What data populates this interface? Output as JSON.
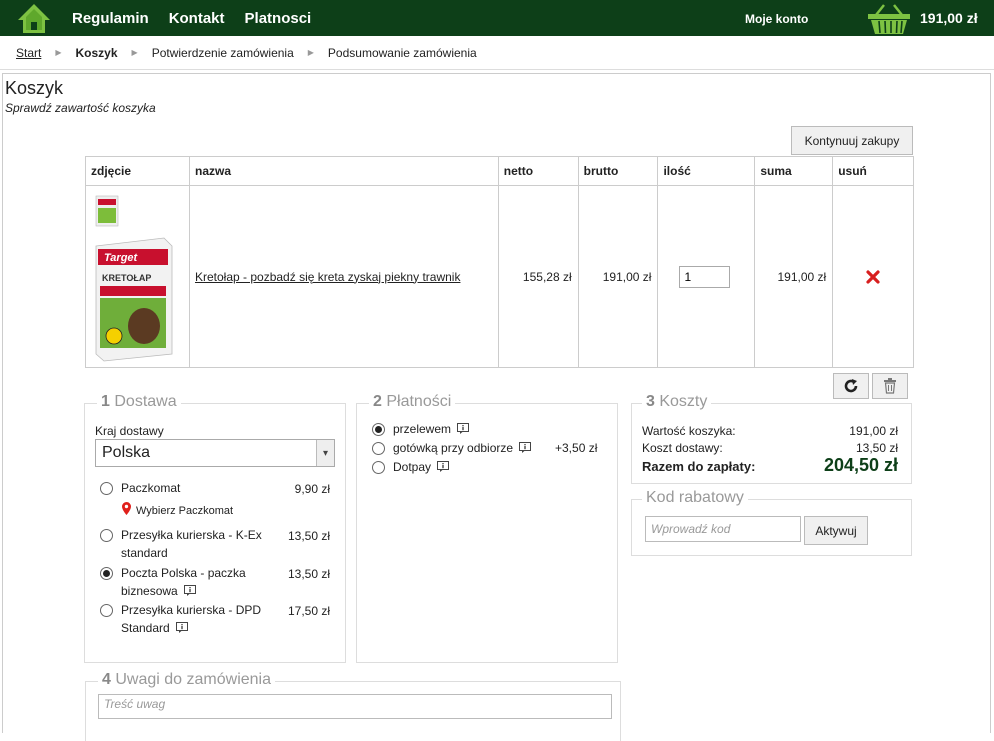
{
  "header": {
    "nav": [
      "Regulamin",
      "Kontakt",
      "Platnosci"
    ],
    "account": "Moje konto",
    "cart_total": "191,00 zł",
    "colors": {
      "bar": "#0d3f18",
      "accent": "#7dc242"
    }
  },
  "breadcrumb": {
    "start": "Start",
    "cart": "Koszyk",
    "confirm": "Potwierdzenie zamówienia",
    "summary": "Podsumowanie zamówienia"
  },
  "page": {
    "title": "Koszyk",
    "subtitle": "Sprawdź zawartość koszyka",
    "continue_button": "Kontynuuj zakupy"
  },
  "table": {
    "headers": [
      "zdjęcie",
      "nazwa",
      "netto",
      "brutto",
      "ilość",
      "suma",
      "usuń"
    ],
    "item": {
      "name": "Kretołap - pozbadź się kreta zyskaj piekny trawnik",
      "netto": "155,28 zł",
      "brutto": "191,00 zł",
      "quantity": "1",
      "sum": "191,00 zł",
      "image_brand": "Target",
      "image_product": "KRETOŁAP"
    }
  },
  "delivery": {
    "num": "1",
    "title": "Dostawa",
    "country_label": "Kraj dostawy",
    "country": "Polska",
    "paczkomat_link": "Wybierz Paczkomat",
    "options": [
      {
        "line1": "Paczkomat",
        "line2": "",
        "price": "9,90 zł",
        "checked": false
      },
      {
        "line1": "Przesyłka kurierska - K-Ex",
        "line2": "standard",
        "price": "13,50 zł",
        "checked": false
      },
      {
        "line1": "Poczta Polska - paczka",
        "line2": "biznesowa",
        "price": "13,50 zł",
        "checked": true
      },
      {
        "line1": "Przesyłka kurierska - DPD",
        "line2": "Standard",
        "price": "17,50 zł",
        "checked": false
      }
    ]
  },
  "payment": {
    "num": "2",
    "title": "Płatności",
    "options": [
      {
        "label": "przelewem",
        "extra": "",
        "checked": true
      },
      {
        "label": "gotówką przy odbiorze",
        "extra": "+3,50 zł",
        "checked": false
      },
      {
        "label": "Dotpay",
        "extra": "",
        "checked": false
      }
    ]
  },
  "costs": {
    "num": "3",
    "title": "Koszty",
    "cart_value_label": "Wartość koszyka:",
    "cart_value": "191,00 zł",
    "shipping_label": "Koszt dostawy:",
    "shipping": "13,50 zł",
    "total_label": "Razem do zapłaty:",
    "total": "204,50 zł"
  },
  "discount": {
    "title": "Kod rabatowy",
    "placeholder": "Wprowadź kod",
    "button": "Aktywuj"
  },
  "notes": {
    "num": "4",
    "title": "Uwagi do zamówienia",
    "placeholder": "Treść uwag"
  }
}
